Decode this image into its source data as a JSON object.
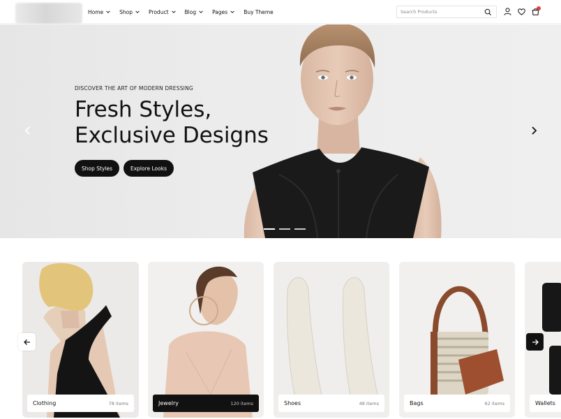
{
  "header": {
    "nav": [
      {
        "label": "Home",
        "dropdown": true
      },
      {
        "label": "Shop",
        "dropdown": true
      },
      {
        "label": "Product",
        "dropdown": true
      },
      {
        "label": "Blog",
        "dropdown": true
      },
      {
        "label": "Pages",
        "dropdown": true
      },
      {
        "label": "Buy Theme",
        "dropdown": false
      }
    ],
    "search_placeholder": "Search Products",
    "icons": [
      "search-icon",
      "user-icon",
      "heart-icon",
      "cart-icon"
    ]
  },
  "hero": {
    "kicker": "DISCOVER THE ART OF MODERN DRESSING",
    "title_line1": "Fresh Styles,",
    "title_line2": "Exclusive Designs",
    "primary_button": "Shop Styles",
    "secondary_button": "Explore Looks",
    "slide_count": 3,
    "active_slide": 1
  },
  "categories": [
    {
      "name": "Clothing",
      "count": "78 items",
      "highlighted": false
    },
    {
      "name": "Jewelry",
      "count": "120 items",
      "highlighted": true
    },
    {
      "name": "Shoes",
      "count": "48 items",
      "highlighted": false
    },
    {
      "name": "Bags",
      "count": "62 items",
      "highlighted": false
    },
    {
      "name": "Wallets",
      "count": "",
      "highlighted": false
    }
  ],
  "colors": {
    "accent": "#111111",
    "badge": "#e23b3b",
    "hero_bg": "#ebebeb"
  }
}
